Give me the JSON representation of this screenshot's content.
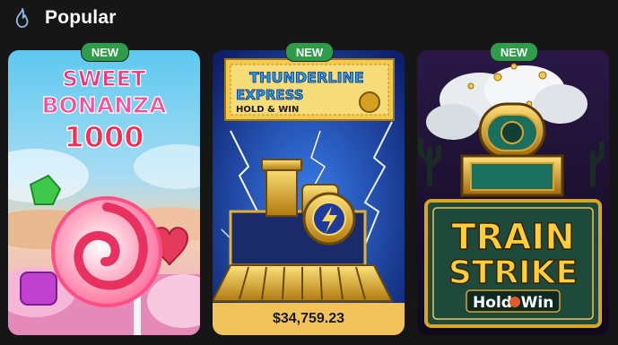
{
  "section": {
    "title": "Popular",
    "icon": "flame-icon"
  },
  "colors": {
    "background": "#161616",
    "badge": "#2e9c48",
    "jackpot_bar": "#f2c35a"
  },
  "games": [
    {
      "id": "sweet-bonanza-1000",
      "badge": "NEW",
      "logo_line1": "SWEET",
      "logo_line2": "BONANZA",
      "logo_line3": "1000"
    },
    {
      "id": "thunderline-express",
      "badge": "NEW",
      "logo_line1": "THUNDERLINE",
      "logo_line2": "EXPRESS",
      "logo_line3": "HOLD & WIN",
      "jackpot": "$34,759.23"
    },
    {
      "id": "train-strike",
      "badge": "NEW",
      "logo_line1": "TRAIN",
      "logo_line2": "STRIKE",
      "logo_line3": "Hold",
      "logo_line4": "Win"
    }
  ]
}
